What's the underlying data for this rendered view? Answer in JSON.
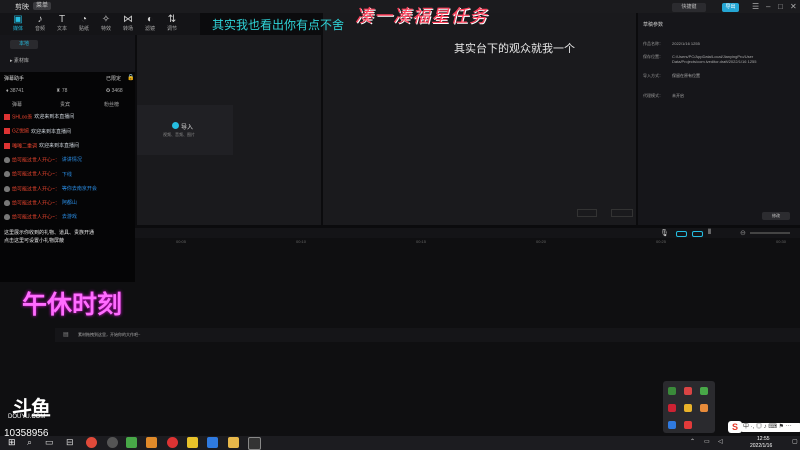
{
  "app": {
    "logo_text": "剪映",
    "menu_label": "菜单",
    "shortcut_label": "快捷键",
    "export_label": "导出"
  },
  "tools": [
    {
      "label": "媒体",
      "icon": "media-icon",
      "glyph": "▣"
    },
    {
      "label": "音频",
      "icon": "audio-icon",
      "glyph": "♪"
    },
    {
      "label": "文本",
      "icon": "text-icon",
      "glyph": "T"
    },
    {
      "label": "贴纸",
      "icon": "sticker-icon",
      "glyph": "◔"
    },
    {
      "label": "特效",
      "icon": "effects-icon",
      "glyph": "✧"
    },
    {
      "label": "转场",
      "icon": "transition-icon",
      "glyph": "⋈"
    },
    {
      "label": "滤镜",
      "icon": "filter-icon",
      "glyph": "◐"
    },
    {
      "label": "调节",
      "icon": "adjust-icon",
      "glyph": "⇅"
    }
  ],
  "left_panel": {
    "tab_local": "本地",
    "tab_import": "▸ 素材库"
  },
  "media": {
    "import_label": "导入",
    "import_hint": "视频、音频、图片"
  },
  "properties": {
    "title": "草稿参数",
    "rows": [
      {
        "key": "作品名称：",
        "value": "2022/1/16 1255"
      },
      {
        "key": "保存位置：",
        "value": "C:/Users/PC/AppData/Local/JianyingPro/User Data/Projects/com.lveditor.draft/2022/1/16 1255"
      },
      {
        "key": "导入方式：",
        "value": "保留在原有位置"
      },
      {
        "key": "代理模式：",
        "value": "未开启"
      }
    ],
    "edit_label": "修改"
  },
  "timeline": {
    "ticks": [
      "00:00",
      "00:05",
      "00:10",
      "00:15",
      "00:20",
      "00:25",
      "00:30"
    ],
    "hint": "素材拖拽到这里，开始你的大作吧~"
  },
  "chat": {
    "title": "弹幕助手",
    "right_label": "已限定",
    "stats": [
      "38741",
      "78",
      "3468"
    ],
    "tabs": [
      "弹幕",
      "贵宾",
      "粉丝榜"
    ],
    "messages": [
      {
        "name": "SHLoo羡",
        "text": "欢迎来到本直播间",
        "badge": "fan",
        "blue": false
      },
      {
        "name": "GZ悦婉",
        "text": "欢迎来到本直播间",
        "badge": "fan",
        "blue": false
      },
      {
        "name": "嘎嘎二重调",
        "text": "欢迎来到本直播间",
        "badge": "fan",
        "blue": false
      },
      {
        "name": "给可能过世人开心~：",
        "text": "讲讲情况",
        "badge": "shield",
        "blue": true
      },
      {
        "name": "给可能过世人开心~：",
        "text": "下线",
        "badge": "shield",
        "blue": true
      },
      {
        "name": "给可能过世人开心~：",
        "text": "等你去南京开会",
        "badge": "shield",
        "blue": true
      },
      {
        "name": "给可能过世人开心~：",
        "text": "阿都山",
        "badge": "shield",
        "blue": true
      },
      {
        "name": "给可能过世人开心~：",
        "text": "去游戏",
        "badge": "shield",
        "blue": true
      }
    ],
    "system_1": "这里展示你收到的礼物、道具、贵族开通",
    "system_2": "点击这里可设置小礼物屏蔽"
  },
  "overlays": {
    "top_caption": "其实我也看出你有点不舍",
    "title_caption": "凑一凑福星任务",
    "mid_caption": "其实台下的观众就我一个",
    "noon_caption": "午休时刻"
  },
  "douyu": {
    "logo": "斗鱼",
    "url": "DOUYU.COM",
    "room_id": "10358956"
  },
  "taskbar": {
    "time": "12:55",
    "date": "2022/1/16",
    "ime": "中 ·, ◎ ♪ ⌨ ⚑ ⋯"
  },
  "colors": {
    "accent": "#25bde0",
    "caption_cyan": "#2fd3d7",
    "caption_pink": "#ff6cff",
    "caption_red": "#ff3f5a"
  }
}
